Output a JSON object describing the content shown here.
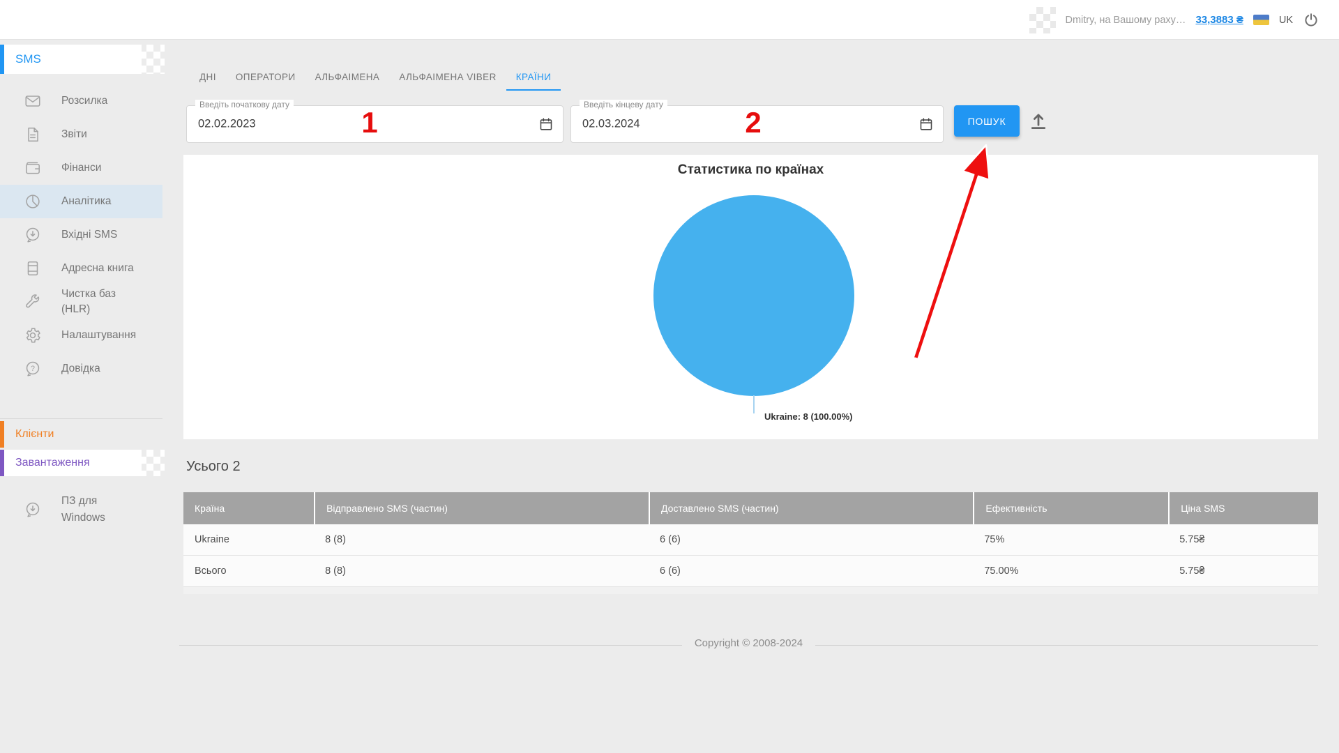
{
  "topbar": {
    "user_text": "Dmitry, на Вашому раху…",
    "balance": "33,3883 ₴",
    "language": "UK"
  },
  "sidebar": {
    "section_title": "SMS",
    "items": [
      {
        "label": "Розсилка"
      },
      {
        "label": "Звіти"
      },
      {
        "label": "Фінанси"
      },
      {
        "label": "Аналітика",
        "active": true
      },
      {
        "label": "Вхідні SMS"
      },
      {
        "label": "Адресна книга"
      },
      {
        "label": "Чистка баз (HLR)"
      },
      {
        "label": "Налаштування"
      },
      {
        "label": "Довідка"
      }
    ],
    "sections": [
      {
        "label": "Клієнти",
        "color": "#f07f23"
      },
      {
        "label": "Завантаження",
        "color": "#7e57c2"
      }
    ],
    "footer_item": "ПЗ для Windows"
  },
  "tabs": {
    "items": [
      {
        "label": "ДНІ"
      },
      {
        "label": "ОПЕРАТОРИ"
      },
      {
        "label": "АЛЬФАІМЕНА"
      },
      {
        "label": "АЛЬФАІМЕНА VIBER"
      },
      {
        "label": "КРАЇНИ",
        "active": true
      }
    ]
  },
  "filters": {
    "start_date": {
      "label": "Введіть початкову дату",
      "value": "02.02.2023"
    },
    "end_date": {
      "label": "Введіть кінцеву дату",
      "value": "02.03.2024"
    },
    "search_button": "ПОШУК"
  },
  "annotations": {
    "step1": "1",
    "step2": "2",
    "arrow_target": "search-button"
  },
  "chart_data": {
    "type": "pie",
    "title": "Статистика по країнах",
    "slices": [
      {
        "label": "Ukraine",
        "value": 8,
        "percent": 100.0,
        "color": "#45b1ee"
      }
    ],
    "point_label": "Ukraine: 8 (100.00%)",
    "legend": "none"
  },
  "summary": {
    "total_label": "Усього 2"
  },
  "table": {
    "columns": [
      "Країна",
      "Відправлено SMS (частин)",
      "Доставлено SMS (частин)",
      "Ефективність",
      "Ціна SMS"
    ],
    "rows": [
      [
        "Ukraine",
        "8 (8)",
        "6 (6)",
        "75%",
        "5.75₴"
      ],
      [
        "Всього",
        "8 (8)",
        "6 (6)",
        "75.00%",
        "5.75₴"
      ]
    ]
  },
  "footer": {
    "copyright": "Copyright © 2008-2024"
  },
  "colors": {
    "accent": "#2196f3",
    "pie": "#45b1ee",
    "annotation_red": "#e60d0d",
    "table_header": "#a3a3a3",
    "clients_orange": "#f07f23",
    "downloads_purple": "#7e57c2",
    "background": "#ececec"
  },
  "icons": {
    "power-icon": "⏻",
    "calendar-icon": "📅",
    "upload-icon": "⬆",
    "mail-icon": "✉",
    "report-icon": "🗎",
    "wallet-icon": "👛",
    "analytics-icon": "◔",
    "inbox-sms-icon": "🗨",
    "address-book-icon": "📖",
    "wrench-icon": "🔧",
    "gear-icon": "⚙",
    "help-icon": "?",
    "download-icon": "⬇",
    "ukraine-flag-icon": "🇺🇦"
  }
}
